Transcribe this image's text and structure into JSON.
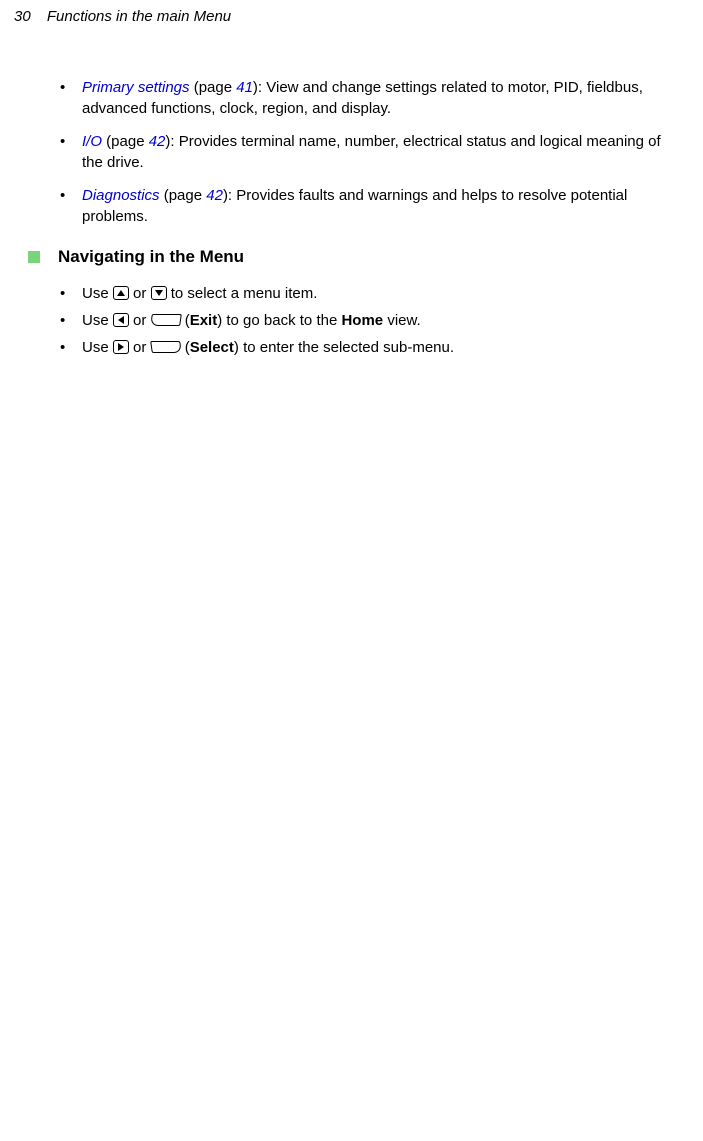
{
  "header": {
    "page_number": "30",
    "section": "Functions in the main Menu"
  },
  "top_bullets": [
    {
      "link_text": "Primary settings",
      "prefix_after_link": " (page ",
      "page_ref": "41",
      "rest": "): View and change settings related to motor, PID, fieldbus, advanced functions, clock, region, and display."
    },
    {
      "link_text": "I/O",
      "prefix_after_link": " (page ",
      "page_ref": "42",
      "rest": "): Provides terminal name, number, electrical status and logical meaning of the drive."
    },
    {
      "link_text": "Diagnostics",
      "prefix_after_link": " (page ",
      "page_ref": "42",
      "rest": "): Provides faults and warnings and helps to resolve potential problems."
    }
  ],
  "heading": "Navigating in the Menu",
  "nav_items": {
    "item1": {
      "use": "Use ",
      "or": " or ",
      "rest": " to select a menu item."
    },
    "item2": {
      "use": "Use ",
      "or": " or ",
      "paren_open": " (",
      "exit": "Exit",
      "mid": ") to go back to the ",
      "home": "Home",
      "rest": " view."
    },
    "item3": {
      "use": "Use ",
      "or": " or ",
      "paren_open": " (",
      "select": "Select",
      "rest": ") to enter the selected sub-menu."
    }
  }
}
